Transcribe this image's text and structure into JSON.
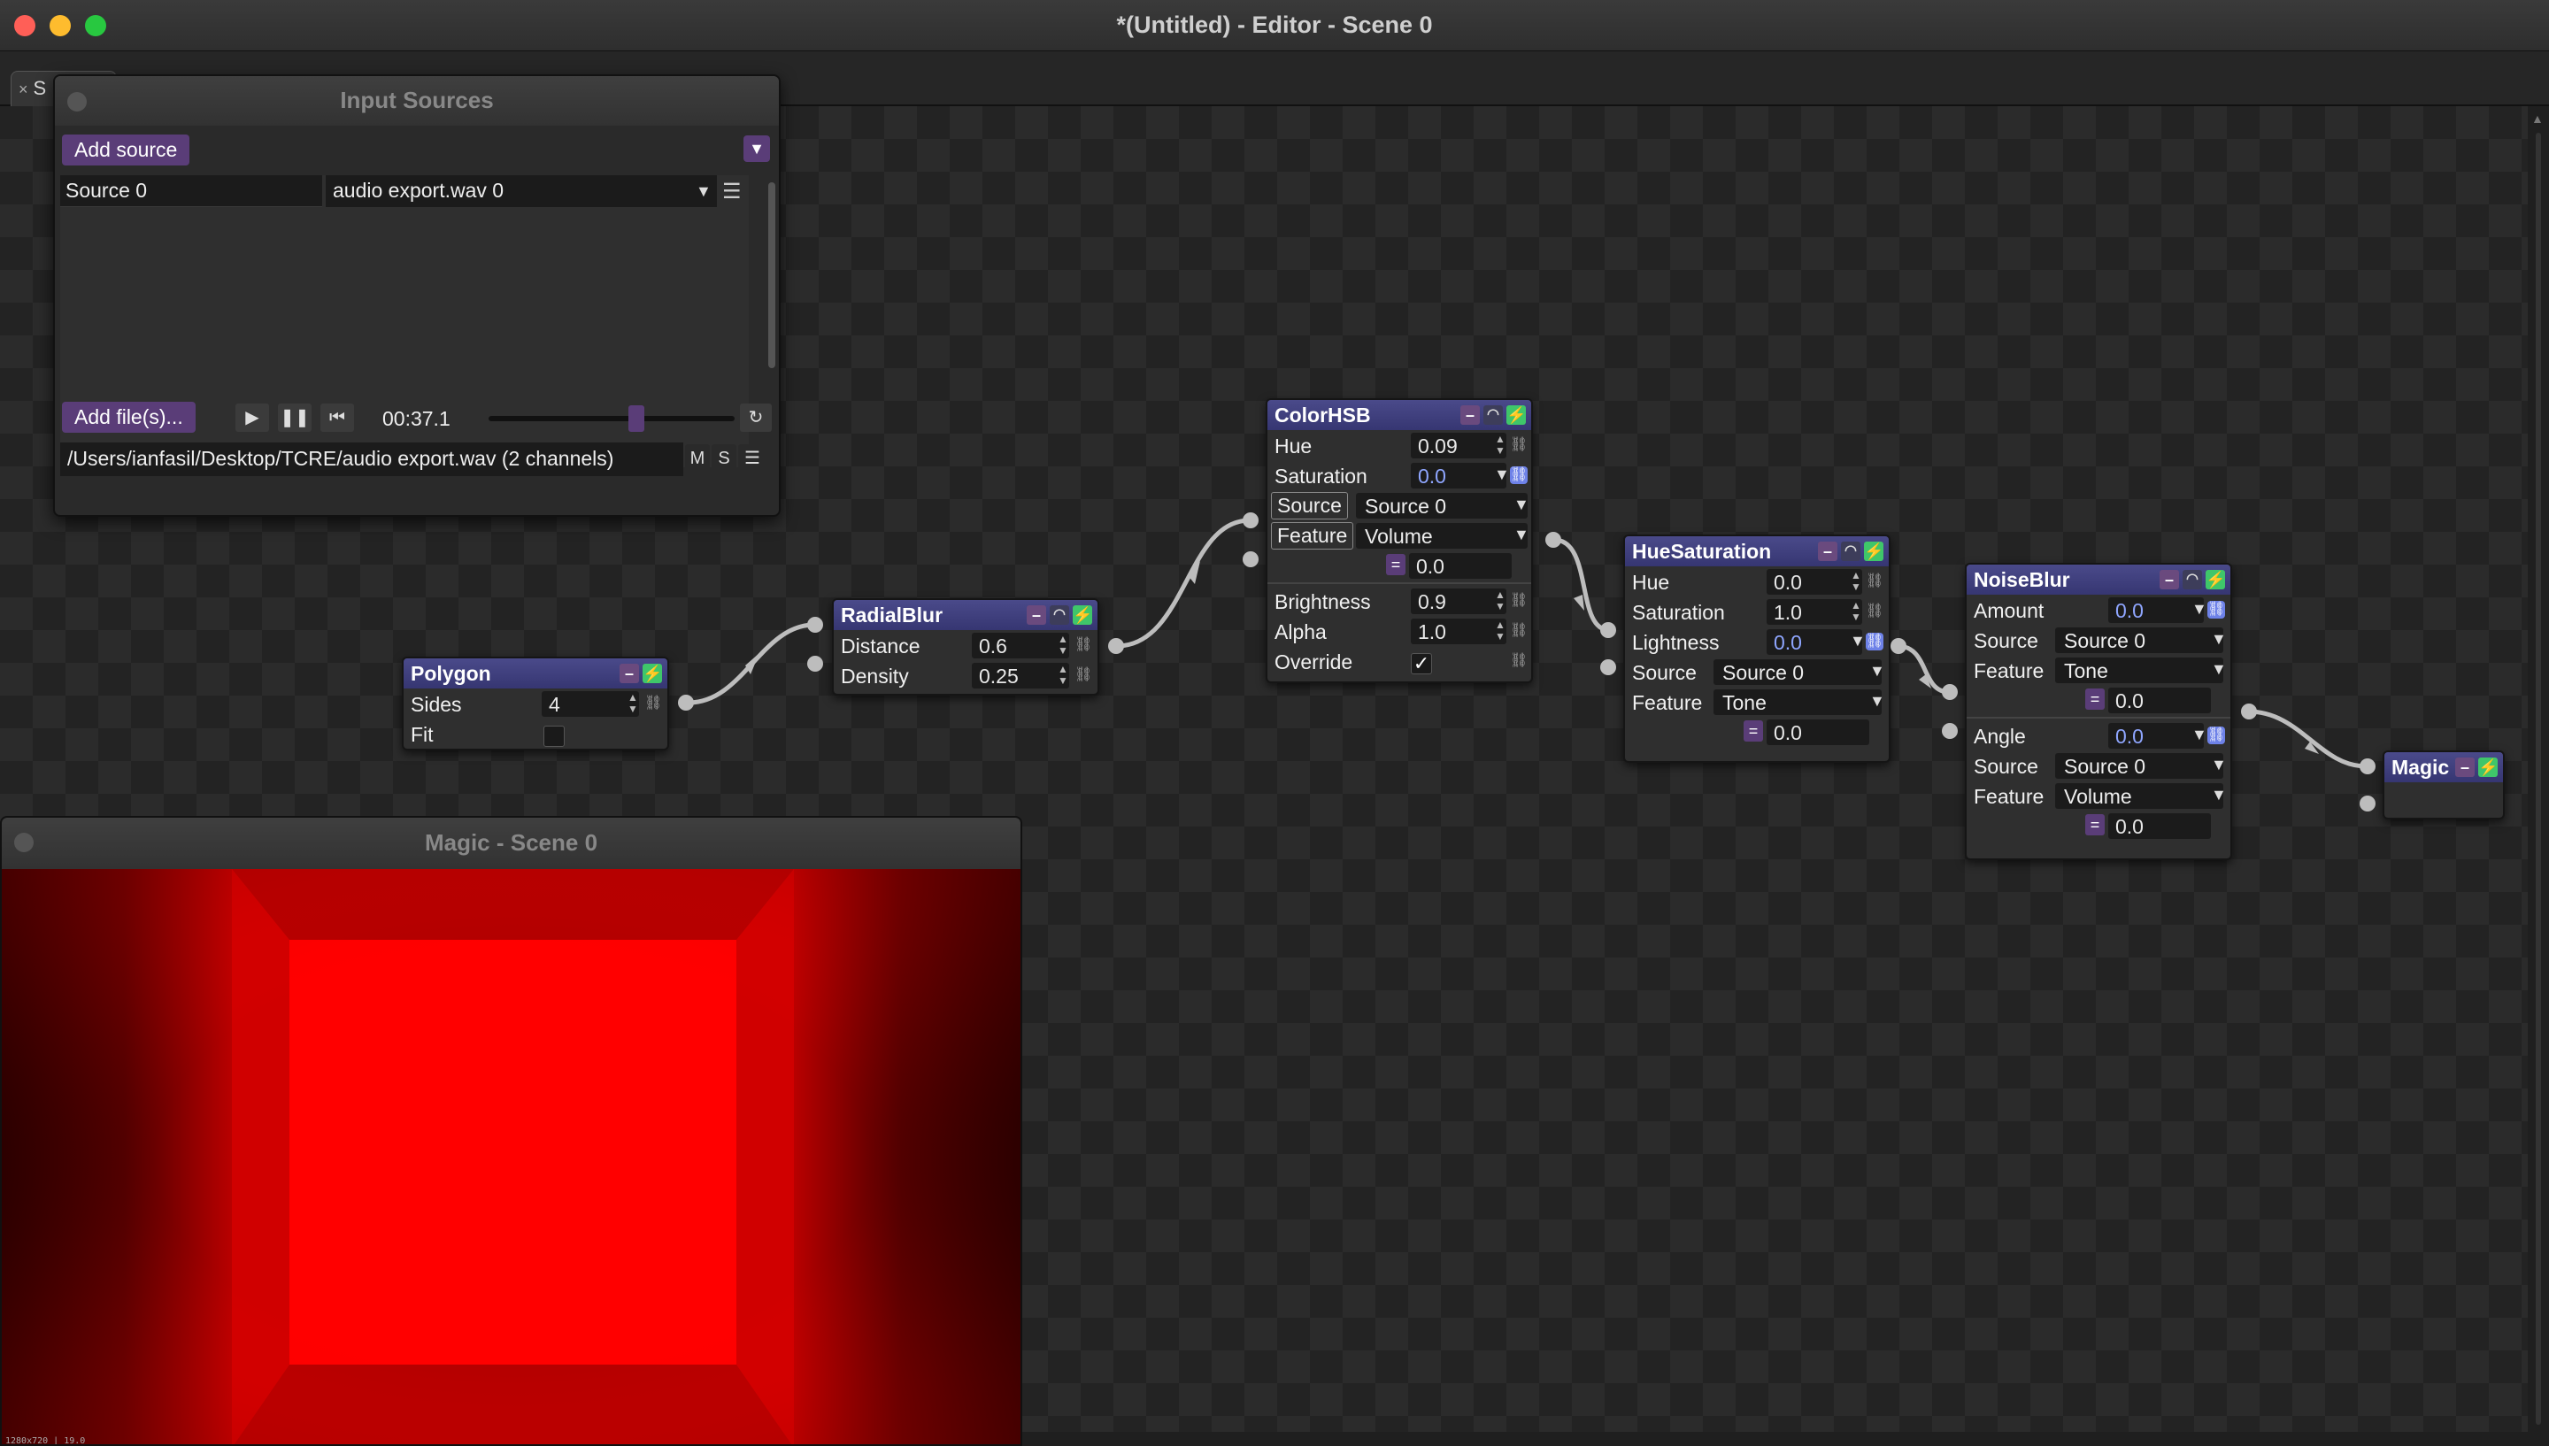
{
  "window": {
    "title": "*(Untitled) - Editor - Scene 0",
    "tab_label": "S",
    "tab_close": "×",
    "traffic_colors": [
      "#ff5f57",
      "#febc2e",
      "#28c840"
    ]
  },
  "input_sources": {
    "title": "Input Sources",
    "add_source_label": "Add source",
    "source_name": "Source 0",
    "source_file": "audio export.wav 0",
    "add_files_label": "Add file(s)...",
    "time": "00:37.1",
    "playback_position": 0.6,
    "file_path": "/Users/ianfasil/Desktop/TCRE/audio export.wav (2 channels)",
    "mute_label": "M",
    "solo_label": "S"
  },
  "nodes": {
    "polygon": {
      "title": "Polygon",
      "sides_label": "Sides",
      "sides_value": "4",
      "fit_label": "Fit"
    },
    "radialblur": {
      "title": "RadialBlur",
      "distance_label": "Distance",
      "distance_value": "0.6",
      "density_label": "Density",
      "density_value": "0.25"
    },
    "colorhsb": {
      "title": "ColorHSB",
      "hue_label": "Hue",
      "hue_value": "0.09",
      "saturation_label": "Saturation",
      "saturation_value": "0.0",
      "source_label": "Source",
      "source_value": "Source 0",
      "feature_label": "Feature",
      "feature_value": "Volume",
      "mod_value": "0.0",
      "brightness_label": "Brightness",
      "brightness_value": "0.9",
      "alpha_label": "Alpha",
      "alpha_value": "1.0",
      "override_label": "Override",
      "override_check": "✓"
    },
    "huesaturation": {
      "title": "HueSaturation",
      "hue_label": "Hue",
      "hue_value": "0.0",
      "saturation_label": "Saturation",
      "saturation_value": "1.0",
      "lightness_label": "Lightness",
      "lightness_value": "0.0",
      "source_label": "Source",
      "source_value": "Source 0",
      "feature_label": "Feature",
      "feature_value": "Tone",
      "mod_value": "0.0"
    },
    "noiseblur": {
      "title": "NoiseBlur",
      "amount_label": "Amount",
      "amount_value": "0.0",
      "source1_label": "Source",
      "source1_value": "Source 0",
      "feature1_label": "Feature",
      "feature1_value": "Tone",
      "mod1_value": "0.0",
      "angle_label": "Angle",
      "angle_value": "0.0",
      "source2_label": "Source",
      "source2_value": "Source 0",
      "feature2_label": "Feature",
      "feature2_value": "Volume",
      "mod2_value": "0.0"
    },
    "magic": {
      "title": "Magic"
    }
  },
  "preview": {
    "title": "Magic - Scene 0",
    "footer": "1280x720 | 19.0",
    "render_color": "#ff0000"
  }
}
